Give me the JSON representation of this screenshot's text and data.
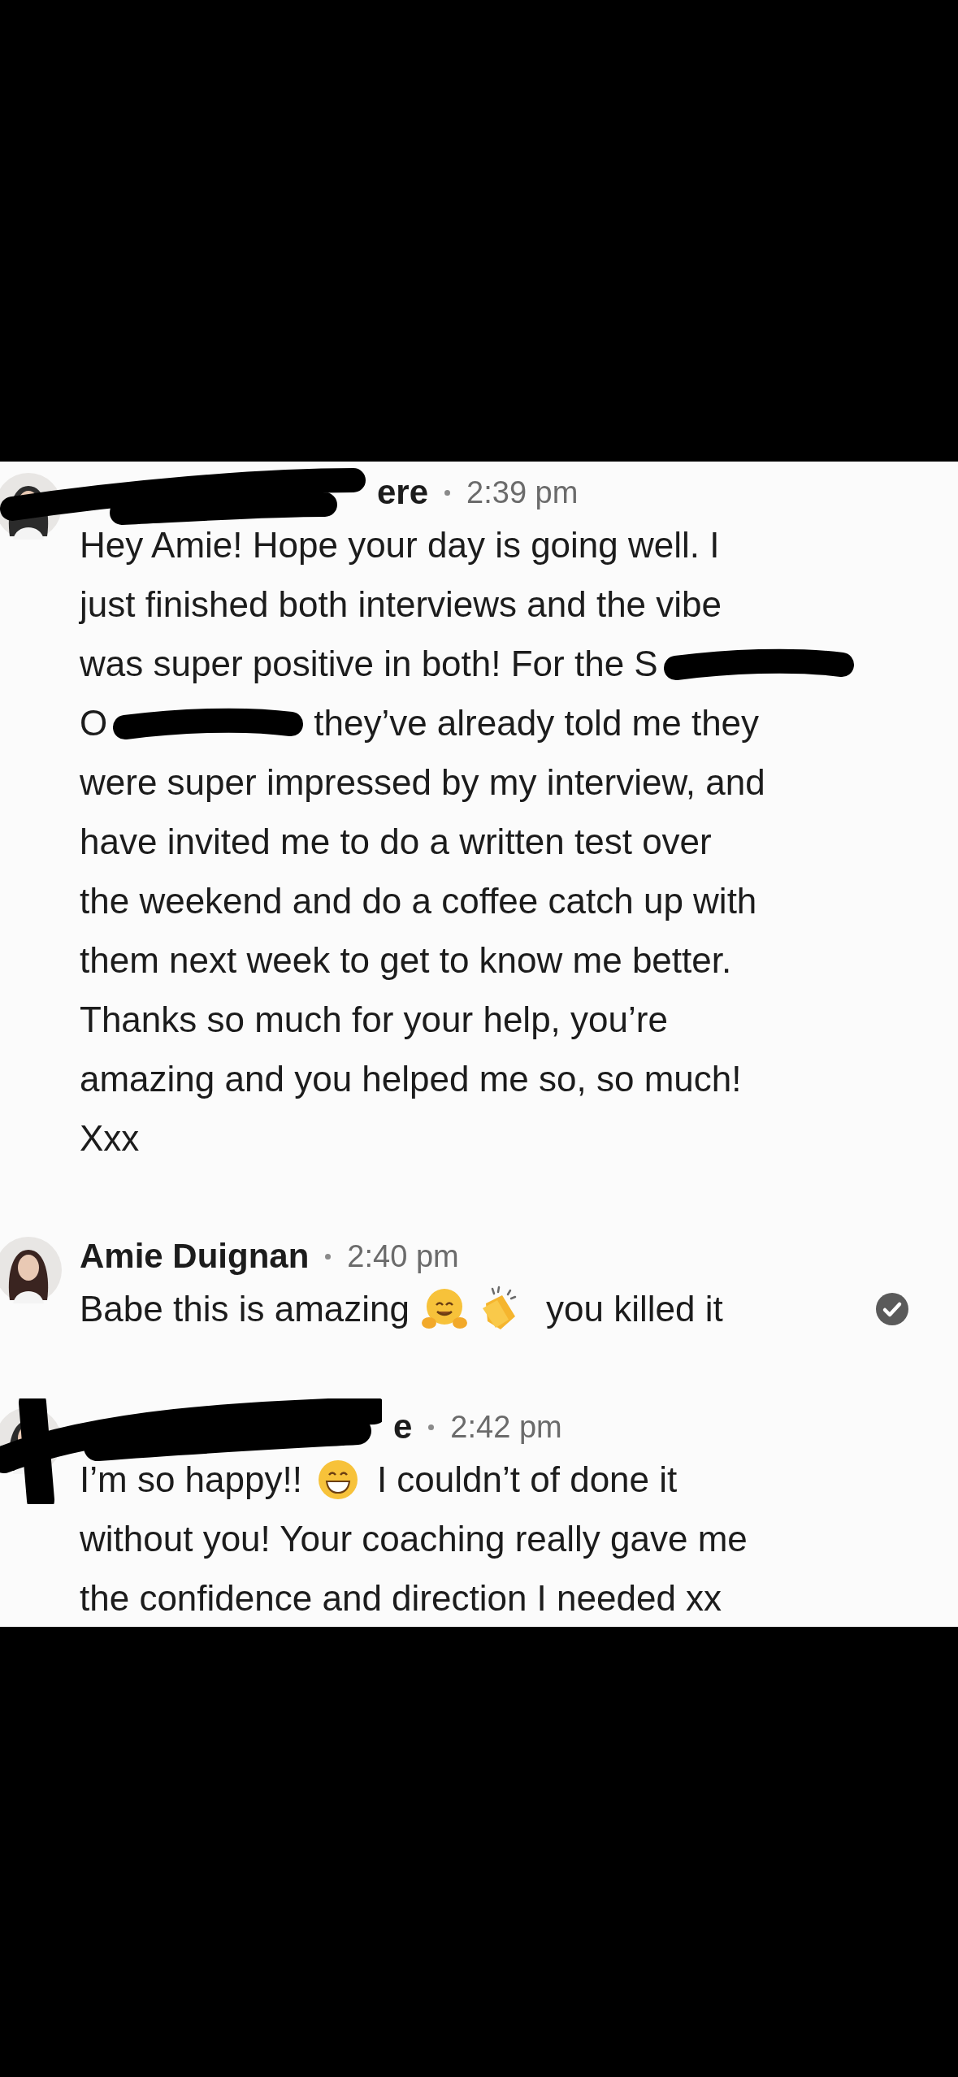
{
  "messages": [
    {
      "sender": [
        {
          "kind": "redaction"
        },
        {
          "kind": "text",
          "text": "ere"
        }
      ],
      "time": "2:39 pm",
      "seen": false,
      "lines": [
        [
          {
            "kind": "text",
            "text": "Hey Amie! Hope your day is going well. I"
          }
        ],
        [
          {
            "kind": "text",
            "text": "just finished both interviews and the vibe"
          }
        ],
        [
          {
            "kind": "text",
            "text": "was super positive in both! For the S"
          },
          {
            "kind": "redaction"
          }
        ],
        [
          {
            "kind": "text",
            "text": "O"
          },
          {
            "kind": "redaction"
          },
          {
            "kind": "text",
            "text": "they’ve already told me they"
          }
        ],
        [
          {
            "kind": "text",
            "text": "were super impressed by my interview, and"
          }
        ],
        [
          {
            "kind": "text",
            "text": "have invited me to do a written test over"
          }
        ],
        [
          {
            "kind": "text",
            "text": "the weekend and do a coffee catch up with"
          }
        ],
        [
          {
            "kind": "text",
            "text": "them next week to get to know me better."
          }
        ],
        [
          {
            "kind": "text",
            "text": "Thanks so much for your help, you’re"
          }
        ],
        [
          {
            "kind": "text",
            "text": "amazing and you helped me so, so much!"
          }
        ],
        [
          {
            "kind": "text",
            "text": "Xxx"
          }
        ]
      ]
    },
    {
      "sender": [
        {
          "kind": "text",
          "text": "Amie Duignan"
        }
      ],
      "time": "2:40 pm",
      "seen": true,
      "lines": [
        [
          {
            "kind": "text",
            "text": "Babe this is amazing"
          },
          {
            "kind": "hug"
          },
          {
            "kind": "clap"
          },
          {
            "kind": "text",
            "text": "you killed it"
          }
        ]
      ]
    },
    {
      "sender": [
        {
          "kind": "redaction"
        },
        {
          "kind": "text",
          "text": "e"
        }
      ],
      "time": "2:42 pm",
      "seen": false,
      "lines": [
        [
          {
            "kind": "text",
            "text": "I’m so happy!!"
          },
          {
            "kind": "grin"
          },
          {
            "kind": "text",
            "text": "I couldn’t of done it"
          }
        ],
        [
          {
            "kind": "text",
            "text": "without you! Your coaching really gave me"
          }
        ],
        [
          {
            "kind": "text",
            "text": "the confidence and direction I needed xx"
          }
        ]
      ]
    }
  ]
}
